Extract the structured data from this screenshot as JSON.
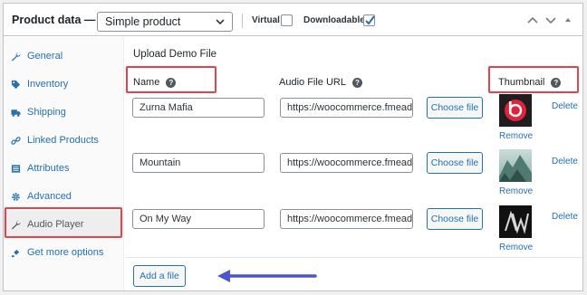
{
  "header": {
    "title": "Product data —",
    "product_type": "Simple product",
    "virtual_label": "Virtual:",
    "virtual_checked": false,
    "downloadable_label": "Downloadable:",
    "downloadable_checked": true
  },
  "sidebar": {
    "items": [
      {
        "label": "General",
        "icon": "wrench-icon"
      },
      {
        "label": "Inventory",
        "icon": "tag-icon"
      },
      {
        "label": "Shipping",
        "icon": "truck-icon"
      },
      {
        "label": "Linked Products",
        "icon": "link-icon"
      },
      {
        "label": "Attributes",
        "icon": "list-icon"
      },
      {
        "label": "Advanced",
        "icon": "gear-icon"
      },
      {
        "label": "Audio Player",
        "icon": "wrench-icon",
        "active": true
      },
      {
        "label": "Get more options",
        "icon": "plugin-icon"
      }
    ]
  },
  "main": {
    "section_title": "Upload Demo File",
    "columns": {
      "name": "Name",
      "url": "Audio File URL",
      "thumbnail": "Thumbnail"
    },
    "rows": [
      {
        "name": "Zurna Mafia",
        "url": "https://woocommerce.fmead",
        "choose": "Choose file",
        "remove": "Remove",
        "delete": "Delete"
      },
      {
        "name": "Mountain",
        "url": "https://woocommerce.fmead",
        "choose": "Choose file",
        "remove": "Remove",
        "delete": "Delete"
      },
      {
        "name": "On My Way",
        "url": "https://woocommerce.fmead",
        "choose": "Choose file",
        "remove": "Remove",
        "delete": "Delete"
      }
    ],
    "add_file": "Add a file"
  },
  "colors": {
    "accent": "#2271b1",
    "highlight": "#e0454f",
    "arrow": "#4a55d6"
  }
}
